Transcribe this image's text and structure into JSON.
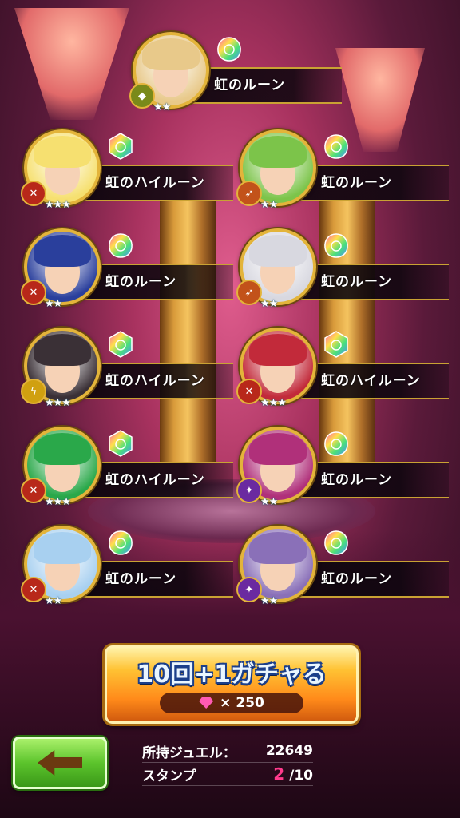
{
  "gacha_results": [
    {
      "item": "虹のルーン",
      "stars": "★★",
      "rune": "rune-icon",
      "type": "shield-icon",
      "accent": "#e8c98a"
    },
    {
      "item": "虹のハイルーン",
      "stars": "★★★",
      "rune": "high-rune-icon",
      "type": "sword-icon",
      "accent": "#f6e070"
    },
    {
      "item": "虹のルーン",
      "stars": "★★",
      "rune": "rune-icon",
      "type": "bow-icon",
      "accent": "#7cc44a"
    },
    {
      "item": "虹のルーン",
      "stars": "★★",
      "rune": "rune-icon",
      "type": "sword-icon",
      "accent": "#2a3f9c"
    },
    {
      "item": "虹のルーン",
      "stars": "★★",
      "rune": "rune-icon",
      "type": "bow-icon",
      "accent": "#d8d8e0"
    },
    {
      "item": "虹のハイルーン",
      "stars": "★★★",
      "rune": "high-rune-icon",
      "type": "lightning-icon",
      "accent": "#3a3036"
    },
    {
      "item": "虹のハイルーン",
      "stars": "★★★",
      "rune": "high-rune-icon",
      "type": "sword-icon",
      "accent": "#c22a3a"
    },
    {
      "item": "虹のハイルーン",
      "stars": "★★★",
      "rune": "high-rune-icon",
      "type": "sword-icon",
      "accent": "#2aa84a"
    },
    {
      "item": "虹のルーン",
      "stars": "★★",
      "rune": "rune-icon",
      "type": "staff-icon",
      "accent": "#b0307a"
    },
    {
      "item": "虹のルーン",
      "stars": "★★",
      "rune": "rune-icon",
      "type": "sword-icon",
      "accent": "#a8d0f0"
    },
    {
      "item": "虹のルーン",
      "stars": "★★",
      "rune": "rune-icon",
      "type": "staff-icon",
      "accent": "#8a70b8"
    }
  ],
  "gacha_button": {
    "label": "10回+1ガチャる",
    "cost": "× 250"
  },
  "status": {
    "jewels_label": "所持ジュエル：",
    "jewels_value": "22649",
    "stamp_label": "スタンプ",
    "stamp_current": "2",
    "stamp_total": "/10"
  },
  "colors": {
    "gold": "#e3b43a",
    "stamp_highlight": "#ff3a8c",
    "back_button": "#5cc42c"
  }
}
